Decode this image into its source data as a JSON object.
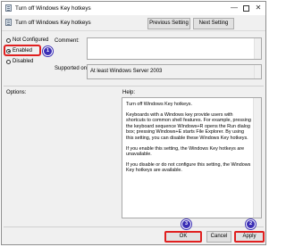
{
  "window": {
    "title": "Turn off Windows Key hotkeys",
    "controls": {
      "minimize": "—",
      "close": "✕"
    }
  },
  "header": {
    "setting_title": "Turn off Windows Key hotkeys",
    "previous_label": "Previous Setting",
    "next_label": "Next Setting"
  },
  "radios": {
    "not_configured": "Not Configured",
    "enabled": "Enabled",
    "disabled": "Disabled",
    "selected": "enabled"
  },
  "labels": {
    "comment": "Comment:",
    "supported_on": "Supported on:",
    "options": "Options:",
    "help": "Help:"
  },
  "supported_value": "At least Windows Server 2003",
  "help_text": [
    "Turn off Windows Key hotkeys.",
    "Keyboards with a Windows key provide users with shortcuts to common shell features. For example, pressing the keyboard sequence Windows+R opens the Run dialog box; pressing Windows+E starts File Explorer. By using this setting, you can disable these Windows Key hotkeys.",
    "If you enable this setting, the Windows Key hotkeys are unavailable.",
    "If you disable or do not configure this setting, the Windows Key hotkeys are available."
  ],
  "buttons": {
    "ok": "OK",
    "cancel": "Cancel",
    "apply": "Apply"
  },
  "annotations": {
    "step1": "1",
    "step2": "2",
    "step3": "3",
    "highlight_color": "#e02020",
    "badge_color": "#3b2fb5"
  }
}
